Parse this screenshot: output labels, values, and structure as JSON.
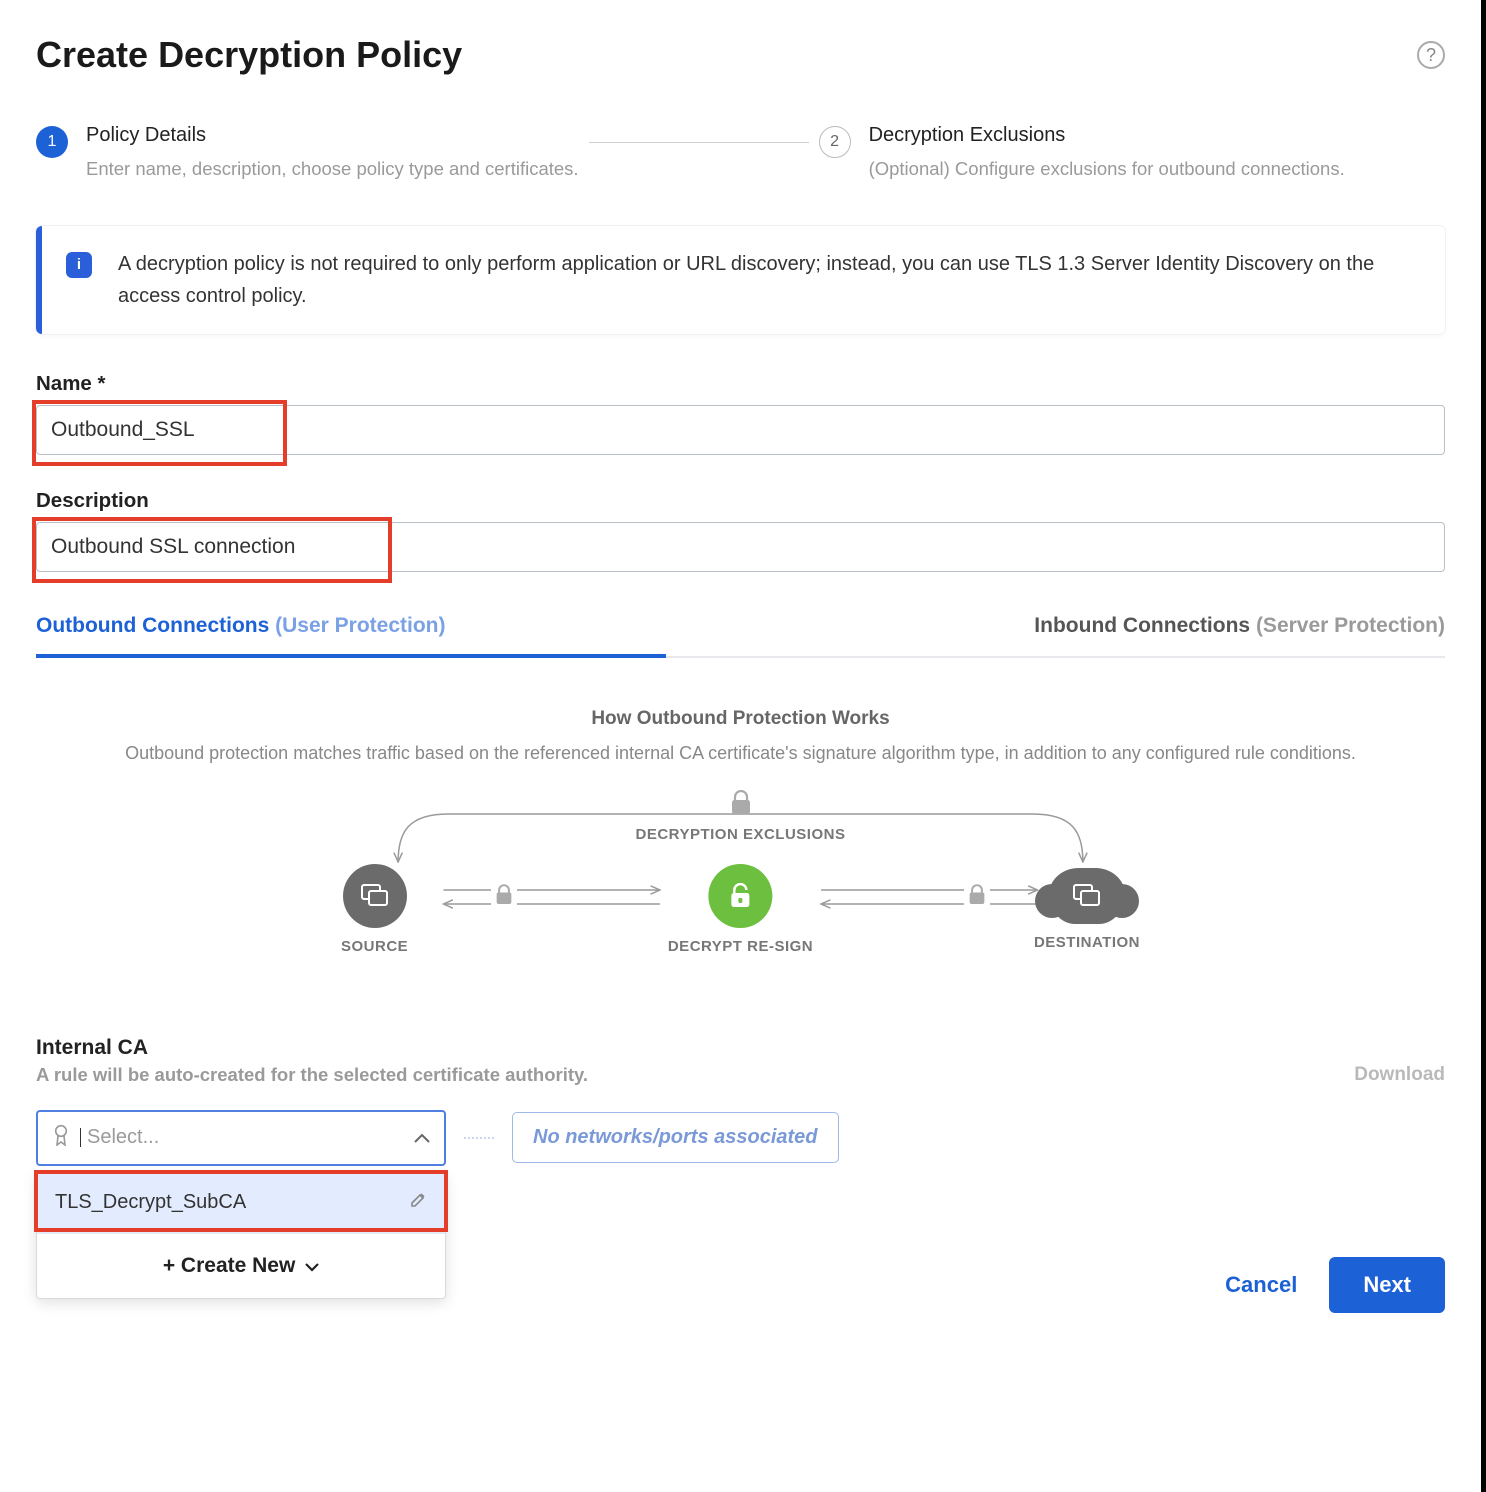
{
  "header": {
    "title": "Create Decryption Policy"
  },
  "steps": [
    {
      "num": "1",
      "name": "Policy Details",
      "desc": "Enter name, description, choose policy type and certificates.",
      "state": "active"
    },
    {
      "num": "2",
      "name": "Decryption Exclusions",
      "desc": "(Optional) Configure exclusions for outbound connections.",
      "state": "inactive"
    }
  ],
  "info": {
    "text": "A decryption policy is not required to only perform application or URL discovery; instead, you can use TLS 1.3 Server Identity Discovery on the access control policy."
  },
  "form": {
    "name_label": "Name *",
    "name_value": "Outbound_SSL",
    "desc_label": "Description",
    "desc_value": "Outbound SSL connection"
  },
  "tabs": {
    "outbound": {
      "label": "Outbound Connections",
      "sub": " (User Protection)"
    },
    "inbound": {
      "label": "Inbound Connections",
      "sub": " (Server Protection)"
    }
  },
  "diagram": {
    "title": "How Outbound Protection Works",
    "desc": "Outbound protection matches traffic based on the referenced internal CA certificate's signature algorithm type, in addition to any configured rule conditions.",
    "exclusions_label": "DECRYPTION EXCLUSIONS",
    "source_label": "SOURCE",
    "middle_label": "DECRYPT RE-SIGN",
    "dest_label": "DESTINATION"
  },
  "internal_ca": {
    "title": "Internal CA",
    "sub": "A rule will be auto-created for the selected certificate authority.",
    "download": "Download",
    "select_placeholder": "Select...",
    "no_networks": "No networks/ports associated",
    "option": "TLS_Decrypt_SubCA",
    "create_new": "+ Create New"
  },
  "footer": {
    "cancel": "Cancel",
    "next": "Next"
  }
}
